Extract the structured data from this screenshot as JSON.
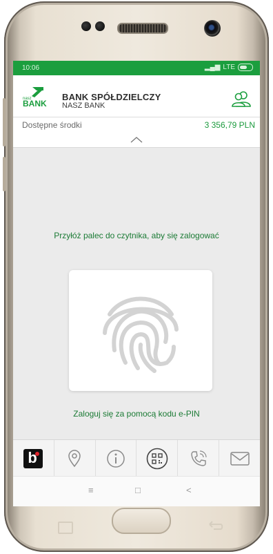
{
  "status_bar": {
    "time": "10:06",
    "network": "LTE"
  },
  "header": {
    "logo_small": "nasz",
    "logo_big": "BANK",
    "bank_name": "BANK SPÓŁDZIELCZY",
    "bank_subname": "NASZ BANK",
    "profile_icon": "users-icon"
  },
  "funds": {
    "label": "Dostępne środki",
    "value": "3 356,79 PLN"
  },
  "login": {
    "instruction": "Przyłóż palec do czytnika, aby się zalogować",
    "fingerprint_icon": "fingerprint-icon",
    "epin_link": "Zaloguj się za pomocą kodu e-PIN"
  },
  "bottom_nav": {
    "items": [
      "blik-icon",
      "location-pin-icon",
      "info-icon",
      "qr-code-icon",
      "phone-icon",
      "mail-icon"
    ],
    "blik_letter": "b"
  },
  "android_nav": {
    "recents": "≡",
    "home": "□",
    "back": "<"
  },
  "colors": {
    "green": "#1b9e3e",
    "text_green": "#1a7a34",
    "status_bar": "#1b9e3e"
  }
}
